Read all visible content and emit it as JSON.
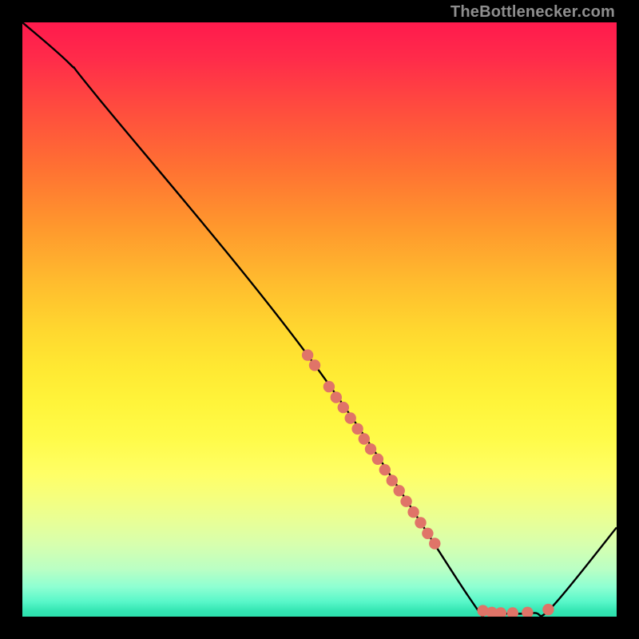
{
  "attribution": "TheBottlenecker.com",
  "colors": {
    "curve": "#000000",
    "point_fill": "#e07468",
    "point_stroke": "#c9564e"
  },
  "chart_data": {
    "type": "line",
    "title": "",
    "xlabel": "",
    "ylabel": "",
    "xlim": [
      0,
      100
    ],
    "ylim": [
      0,
      100
    ],
    "curve": [
      {
        "x": 0,
        "y": 100
      },
      {
        "x": 8,
        "y": 93
      },
      {
        "x": 13,
        "y": 87
      },
      {
        "x": 48,
        "y": 44
      },
      {
        "x": 75,
        "y": 3.5
      },
      {
        "x": 77,
        "y": 1.5
      },
      {
        "x": 80,
        "y": 0.6
      },
      {
        "x": 86,
        "y": 0.6
      },
      {
        "x": 89,
        "y": 1.5
      },
      {
        "x": 100,
        "y": 15
      }
    ],
    "line_points": [
      {
        "x": 48.0,
        "y": 44.0
      },
      {
        "x": 49.2,
        "y": 42.3
      },
      {
        "x": 51.6,
        "y": 38.7
      },
      {
        "x": 52.8,
        "y": 36.9
      },
      {
        "x": 54.0,
        "y": 35.2
      },
      {
        "x": 55.2,
        "y": 33.4
      },
      {
        "x": 56.4,
        "y": 31.6
      },
      {
        "x": 57.5,
        "y": 29.9
      },
      {
        "x": 58.6,
        "y": 28.2
      },
      {
        "x": 59.8,
        "y": 26.5
      },
      {
        "x": 61.0,
        "y": 24.7
      },
      {
        "x": 62.2,
        "y": 22.9
      },
      {
        "x": 63.4,
        "y": 21.2
      },
      {
        "x": 64.6,
        "y": 19.4
      },
      {
        "x": 65.8,
        "y": 17.6
      },
      {
        "x": 67.0,
        "y": 15.8
      },
      {
        "x": 68.2,
        "y": 14.0
      },
      {
        "x": 69.4,
        "y": 12.3
      }
    ],
    "bottom_points": [
      {
        "x": 77.5,
        "y": 1.0
      },
      {
        "x": 79.0,
        "y": 0.7
      },
      {
        "x": 80.5,
        "y": 0.6
      },
      {
        "x": 82.5,
        "y": 0.6
      },
      {
        "x": 85.0,
        "y": 0.7
      },
      {
        "x": 88.5,
        "y": 1.2
      }
    ]
  }
}
